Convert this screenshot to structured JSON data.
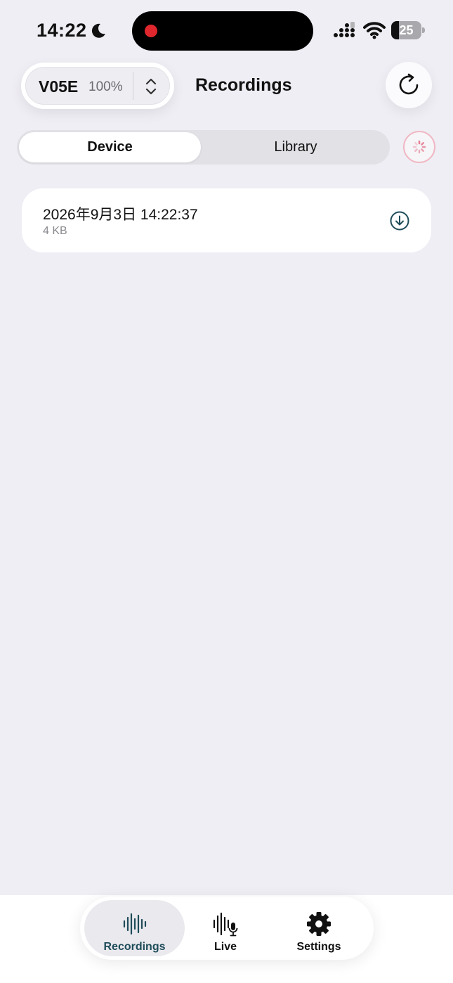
{
  "status_bar": {
    "time": "14:22",
    "battery_level": "25",
    "recording_indicator_color": "#e0272d",
    "icons": [
      "moon-icon",
      "signal-icon",
      "wifi-icon",
      "battery-icon"
    ]
  },
  "header": {
    "device_name": "V05E",
    "device_battery": "100%",
    "title": "Recordings",
    "icons": [
      "chevron-updown-icon",
      "refresh-icon"
    ]
  },
  "segments": {
    "items": [
      {
        "label": "Device",
        "selected": true
      },
      {
        "label": "Library",
        "selected": false
      }
    ],
    "spinner_icon": "loading-spinner-icon",
    "spinner_color": "#f0b8c4"
  },
  "recordings": [
    {
      "title": "2026年9月3日 14:22:37",
      "size": "4 KB",
      "action_icon": "download-icon"
    }
  ],
  "tabs": [
    {
      "label": "Recordings",
      "icon": "waveform-icon",
      "selected": true
    },
    {
      "label": "Live",
      "icon": "waveform-mic-icon",
      "selected": false
    },
    {
      "label": "Settings",
      "icon": "gear-icon",
      "selected": false
    }
  ],
  "colors": {
    "background": "#efeef4",
    "accent": "#1f4c59",
    "card": "#ffffff"
  }
}
